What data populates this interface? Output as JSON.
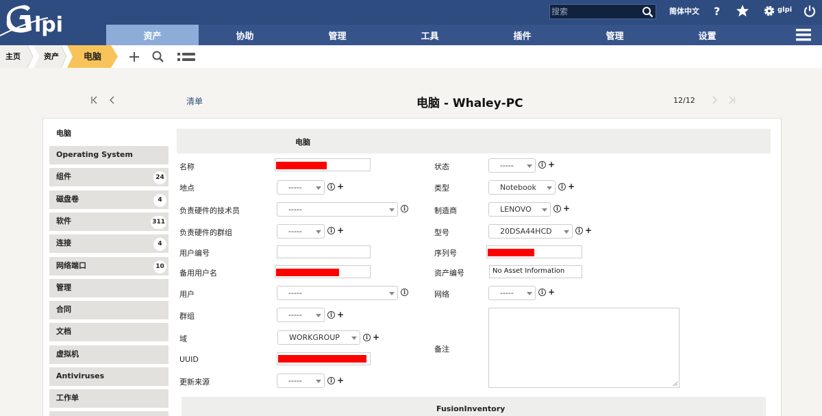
{
  "header": {
    "logo_text": "Glpi",
    "search_placeholder": "搜索",
    "language": "简体中文",
    "user": "glpi"
  },
  "menu": [
    "资产",
    "协助",
    "管理",
    "工具",
    "插件",
    "管理",
    "设置"
  ],
  "breadcrumb": {
    "home": "主页",
    "section": "资产",
    "current": "电脑"
  },
  "nav": {
    "list_link": "清单",
    "title": "电脑 - Whaley-PC",
    "count": "12/12"
  },
  "tabs": [
    {
      "label": "电脑",
      "count": ""
    },
    {
      "label": "Operating System",
      "count": ""
    },
    {
      "label": "组件",
      "count": "24"
    },
    {
      "label": "磁盘卷",
      "count": "4"
    },
    {
      "label": "软件",
      "count": "311"
    },
    {
      "label": "连接",
      "count": "4"
    },
    {
      "label": "网络端口",
      "count": "10"
    },
    {
      "label": "管理",
      "count": ""
    },
    {
      "label": "合同",
      "count": ""
    },
    {
      "label": "文档",
      "count": ""
    },
    {
      "label": "虚拟机",
      "count": ""
    },
    {
      "label": "Antiviruses",
      "count": ""
    },
    {
      "label": "工作单",
      "count": ""
    }
  ],
  "form": {
    "section_title": "电脑",
    "left": {
      "name_label": "名称",
      "location_label": "地点",
      "location_value": "-----",
      "tech_user_label": "负责硬件的技术员",
      "tech_user_value": "-----",
      "tech_group_label": "负责硬件的群组",
      "tech_group_value": "-----",
      "user_number_label": "用户编号",
      "alt_user_label": "备用用户名",
      "user_label": "用户",
      "user_value": "-----",
      "group_label": "群组",
      "group_value": "-----",
      "domain_label": "域",
      "domain_value": "WORKGROUP",
      "uuid_label": "UUID",
      "update_source_label": "更新来源",
      "update_source_value": "-----"
    },
    "right": {
      "status_label": "状态",
      "status_value": "-----",
      "type_label": "类型",
      "type_value": "Notebook",
      "manufacturer_label": "制造商",
      "manufacturer_value": "LENOVO",
      "model_label": "型号",
      "model_value": "20DSA44HCD",
      "serial_label": "序列号",
      "asset_number_label": "资产编号",
      "asset_number_value": "No Asset Information",
      "network_label": "网络",
      "network_value": "-----",
      "comments_label": "备注"
    },
    "subsection_title": "FusionInventory"
  },
  "colors": {
    "header_bg": "#2e4c80",
    "menu_active": "#8eacd8",
    "breadcrumb_active": "#f8c35a",
    "redaction": "#ff0000"
  }
}
